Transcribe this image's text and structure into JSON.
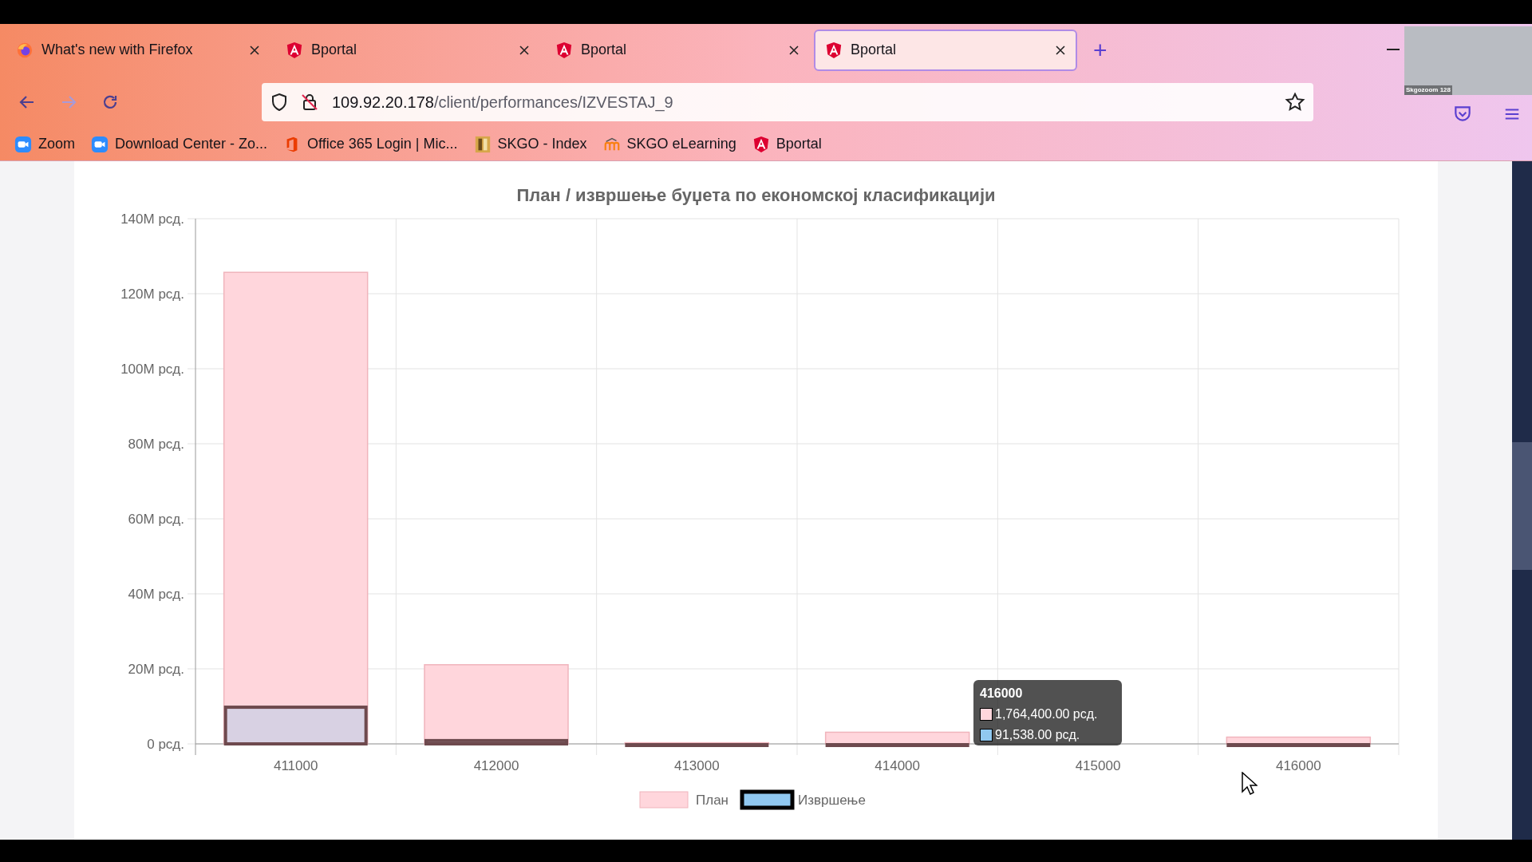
{
  "browser": {
    "tabs": [
      {
        "title": "What's new with Firefox",
        "kind": "firefox",
        "selected": false
      },
      {
        "title": "Bportal",
        "kind": "angular",
        "selected": false
      },
      {
        "title": "Bportal",
        "kind": "angular",
        "selected": false
      },
      {
        "title": "Bportal",
        "kind": "angular",
        "selected": true
      }
    ],
    "new_tab": "+",
    "url": {
      "host": "109.92.20.178",
      "path": "/client/performances/IZVESTAJ_9"
    },
    "bookmarks": [
      {
        "title": "Zoom",
        "kind": "zoom"
      },
      {
        "title": "Download Center - Zo...",
        "kind": "zoom"
      },
      {
        "title": "Office 365 Login | Mic...",
        "kind": "office"
      },
      {
        "title": "SKGO - Index",
        "kind": "skgo"
      },
      {
        "title": "SKGO eLearning",
        "kind": "moodle"
      },
      {
        "title": "Bportal",
        "kind": "angular"
      }
    ]
  },
  "video_overlay": {
    "label": "Skgozoom 128"
  },
  "page": {
    "chart_data": {
      "type": "bar",
      "title": "План / извршење буџета по економској класификацији",
      "categories": [
        "411000",
        "412000",
        "413000",
        "414000",
        "415000",
        "416000"
      ],
      "series": [
        {
          "name": "План",
          "color": "#ffd6dc",
          "values": [
            125700000,
            21100000,
            300000,
            3100000,
            null,
            1800000
          ]
        },
        {
          "name": "Извршење",
          "color": "#90c8f0",
          "values": [
            10200000,
            1300000,
            0,
            200000,
            null,
            100000
          ]
        }
      ],
      "grid": true,
      "legend": true,
      "ylim": [
        0,
        140000000
      ],
      "yticks": [
        {
          "value": 0,
          "label": "0 рсд."
        },
        {
          "value": 20000000,
          "label": "20M рсд."
        },
        {
          "value": 40000000,
          "label": "40M рсд."
        },
        {
          "value": 60000000,
          "label": "60M рсд."
        },
        {
          "value": 80000000,
          "label": "80M рсд."
        },
        {
          "value": 100000000,
          "label": "100M рсд."
        },
        {
          "value": 120000000,
          "label": "120M рсд."
        },
        {
          "value": 140000000,
          "label": "140M рсд."
        }
      ]
    },
    "tooltip": {
      "title": "416000",
      "items": [
        {
          "value": "1,764,400.00 рсд.",
          "color": "#ffd6dc"
        },
        {
          "value": "91,538.00 рсд.",
          "color": "#90c8f0"
        }
      ]
    }
  }
}
